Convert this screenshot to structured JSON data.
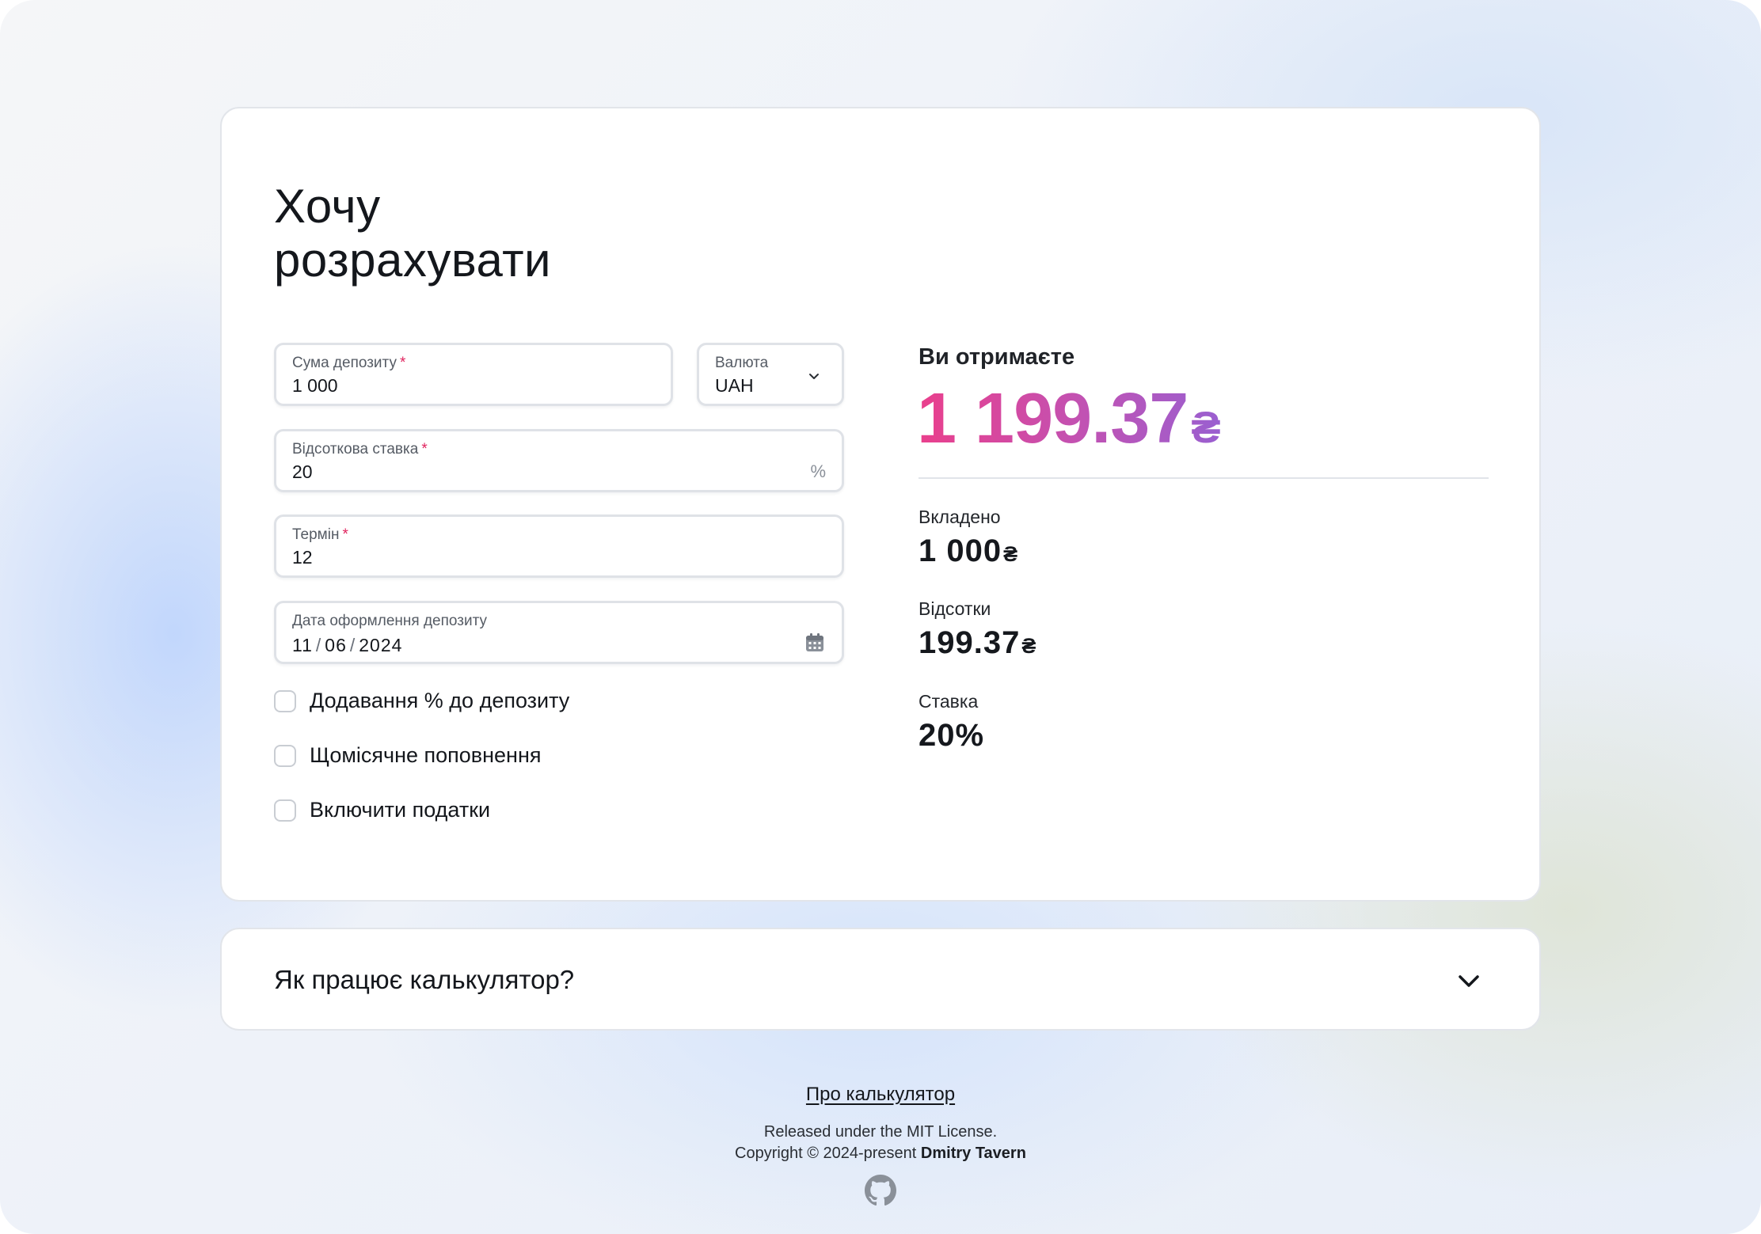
{
  "form": {
    "title_line1": "Хочу",
    "title_line2": "розрахувати",
    "amount": {
      "label": "Сума депозиту",
      "required_mark": "*",
      "value": "1 000"
    },
    "currency": {
      "label": "Валюта",
      "value": "UAH"
    },
    "rate": {
      "label": "Відсоткова ставка",
      "required_mark": "*",
      "value": "20",
      "suffix": "%"
    },
    "term": {
      "label": "Термін",
      "required_mark": "*",
      "value": "12"
    },
    "date": {
      "label": "Дата оформлення депозиту",
      "day": "11",
      "month": "06",
      "year": "2024",
      "separator": "/"
    },
    "checkboxes": [
      {
        "label": "Додавання % до депозиту",
        "checked": false
      },
      {
        "label": "Щомісячне поповнення",
        "checked": false
      },
      {
        "label": "Включити податки",
        "checked": false
      }
    ]
  },
  "result": {
    "label": "Ви отримаєте",
    "total": "1 199.37",
    "currency_symbol": "₴",
    "invested_label": "Вкладено",
    "invested_value": "1 000",
    "interest_label": "Відсотки",
    "interest_value": "199.37",
    "rate_label": "Ставка",
    "rate_value": "20%",
    "gradient_colors": [
      "#ea3f8c",
      "#c152b3",
      "#9a5fd0"
    ]
  },
  "faq": {
    "question": "Як працює калькулятор?"
  },
  "footer": {
    "about_link": "Про калькулятор",
    "license_line": "Released under the MIT License.",
    "copyright_prefix": "Copyright © 2024-present",
    "author": "Dmitry Tavern",
    "github_icon": "github-icon"
  },
  "colors": {
    "required": "#e0245e",
    "text": "#14171c",
    "border": "#dfe2e7"
  }
}
